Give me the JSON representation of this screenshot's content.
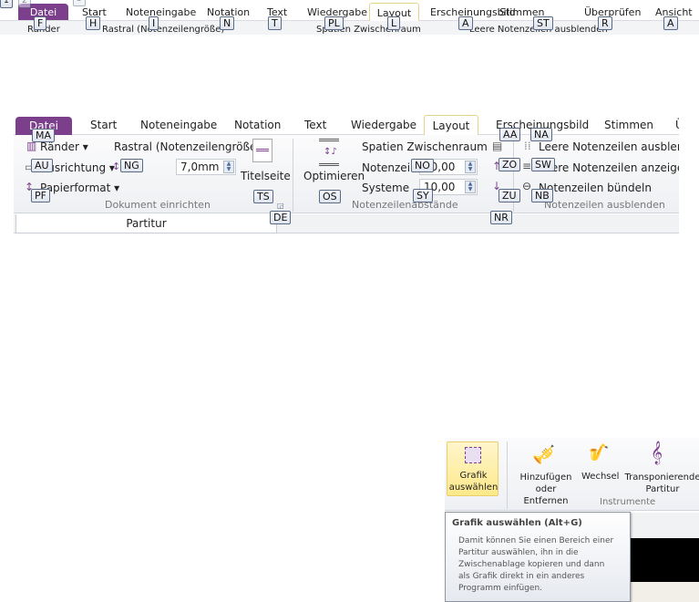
{
  "strip1": {
    "qat_keytips": [
      "1",
      "2",
      "3"
    ],
    "tabs": [
      {
        "label": "Datei",
        "key": "F"
      },
      {
        "label": "Start",
        "key": "H"
      },
      {
        "label": "Noteneingabe",
        "key": "I"
      },
      {
        "label": "Notation",
        "key": "N"
      },
      {
        "label": "Text",
        "key": "T"
      },
      {
        "label": "Wiedergabe",
        "key": "PL"
      },
      {
        "label": "Layout",
        "key": "L"
      },
      {
        "label": "Erscheinungsbild",
        "key": "A"
      },
      {
        "label": "Stimmen",
        "key": "ST"
      },
      {
        "label": "Überprüfen",
        "key": "R"
      },
      {
        "label": "Ansicht",
        "key": "A"
      }
    ],
    "row": {
      "raender": "Ränder",
      "rastral": "Rastral (Notenzeilengröße)",
      "spatien": "Spatien Zwischenraum",
      "leere": "Leere Notenzeilen ausblenden"
    }
  },
  "ribbon": {
    "tabs": [
      "Datei",
      "Start",
      "Noteneingabe",
      "Notation",
      "Text",
      "Wiedergabe",
      "Layout",
      "Erscheinungsbild",
      "Stimmen",
      "Ü"
    ],
    "active_tab": "Layout",
    "dokument": {
      "raender": "Ränder",
      "ausrichtung": "Ausrichtung",
      "papierformat": "Papierformat",
      "rastral": "Rastral (Notenzeilengröße)",
      "rastral_value": "7,0mm",
      "titelseite": "Titelseite",
      "group": "Dokument einrichten"
    },
    "abstaende": {
      "optimieren": "Optimieren",
      "spatien": "Spatien Zwischenraum",
      "notenzeilen": "Notenzeilen",
      "notenzeilen_value": "10,00",
      "systeme": "Systeme",
      "systeme_value": "10,00",
      "group": "Notenzeilenabstände"
    },
    "ausblenden": {
      "leere_aus": "Leere Notenzeilen ausblenden",
      "leere_an": "Leere Notenzeilen anzeigen",
      "buendeln": "Notenzeilen bündeln",
      "group": "Notenzeilen ausblenden"
    },
    "keytips": {
      "MA": "MA",
      "AU": "AU",
      "PF": "PF",
      "NG": "NG",
      "TS": "TS",
      "DE": "DE",
      "OS": "OS",
      "NO": "NO",
      "SY": "SY",
      "AA": "AA",
      "NA": "NA",
      "ZO": "ZO",
      "SW": "SW",
      "ZU": "ZU",
      "NB": "NB",
      "NR": "NR"
    },
    "doc_tab": "Partitur"
  },
  "panel3": {
    "grafik": "Grafik auswählen",
    "hinzufuegen": "Hinzufügen oder Entfernen",
    "wechsel": "Wechsel",
    "transponierende": "Transponierende Partitur",
    "group": "Instrumente",
    "tooltip": {
      "title": "Grafik auswählen (Alt+G)",
      "body": "Damit können Sie einen Bereich einer Partitur auswählen, ihn in die Zwischenablage kopieren und dann als Grafik direkt in ein anderes Programm einfügen."
    }
  },
  "colors": {
    "datei": "#7b3f8c",
    "layout_tab_border": "#e6d38a",
    "highlight": "#fde98a"
  }
}
